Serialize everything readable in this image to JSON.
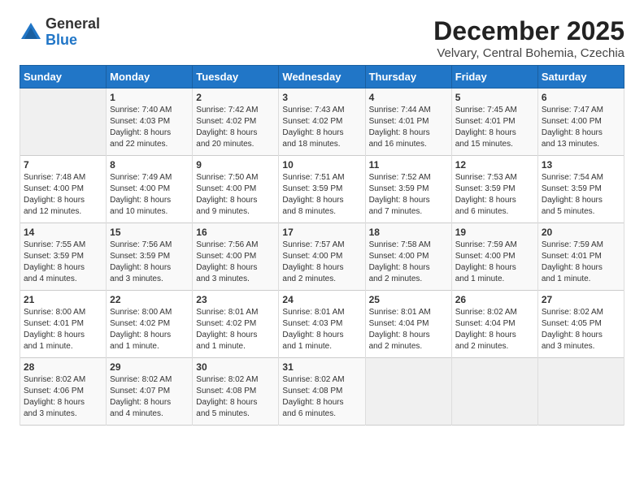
{
  "logo": {
    "general": "General",
    "blue": "Blue"
  },
  "header": {
    "month": "December 2025",
    "location": "Velvary, Central Bohemia, Czechia"
  },
  "days_of_week": [
    "Sunday",
    "Monday",
    "Tuesday",
    "Wednesday",
    "Thursday",
    "Friday",
    "Saturday"
  ],
  "weeks": [
    [
      {
        "day": "",
        "info": ""
      },
      {
        "day": "1",
        "info": "Sunrise: 7:40 AM\nSunset: 4:03 PM\nDaylight: 8 hours\nand 22 minutes."
      },
      {
        "day": "2",
        "info": "Sunrise: 7:42 AM\nSunset: 4:02 PM\nDaylight: 8 hours\nand 20 minutes."
      },
      {
        "day": "3",
        "info": "Sunrise: 7:43 AM\nSunset: 4:02 PM\nDaylight: 8 hours\nand 18 minutes."
      },
      {
        "day": "4",
        "info": "Sunrise: 7:44 AM\nSunset: 4:01 PM\nDaylight: 8 hours\nand 16 minutes."
      },
      {
        "day": "5",
        "info": "Sunrise: 7:45 AM\nSunset: 4:01 PM\nDaylight: 8 hours\nand 15 minutes."
      },
      {
        "day": "6",
        "info": "Sunrise: 7:47 AM\nSunset: 4:00 PM\nDaylight: 8 hours\nand 13 minutes."
      }
    ],
    [
      {
        "day": "7",
        "info": "Sunrise: 7:48 AM\nSunset: 4:00 PM\nDaylight: 8 hours\nand 12 minutes."
      },
      {
        "day": "8",
        "info": "Sunrise: 7:49 AM\nSunset: 4:00 PM\nDaylight: 8 hours\nand 10 minutes."
      },
      {
        "day": "9",
        "info": "Sunrise: 7:50 AM\nSunset: 4:00 PM\nDaylight: 8 hours\nand 9 minutes."
      },
      {
        "day": "10",
        "info": "Sunrise: 7:51 AM\nSunset: 3:59 PM\nDaylight: 8 hours\nand 8 minutes."
      },
      {
        "day": "11",
        "info": "Sunrise: 7:52 AM\nSunset: 3:59 PM\nDaylight: 8 hours\nand 7 minutes."
      },
      {
        "day": "12",
        "info": "Sunrise: 7:53 AM\nSunset: 3:59 PM\nDaylight: 8 hours\nand 6 minutes."
      },
      {
        "day": "13",
        "info": "Sunrise: 7:54 AM\nSunset: 3:59 PM\nDaylight: 8 hours\nand 5 minutes."
      }
    ],
    [
      {
        "day": "14",
        "info": "Sunrise: 7:55 AM\nSunset: 3:59 PM\nDaylight: 8 hours\nand 4 minutes."
      },
      {
        "day": "15",
        "info": "Sunrise: 7:56 AM\nSunset: 3:59 PM\nDaylight: 8 hours\nand 3 minutes."
      },
      {
        "day": "16",
        "info": "Sunrise: 7:56 AM\nSunset: 4:00 PM\nDaylight: 8 hours\nand 3 minutes."
      },
      {
        "day": "17",
        "info": "Sunrise: 7:57 AM\nSunset: 4:00 PM\nDaylight: 8 hours\nand 2 minutes."
      },
      {
        "day": "18",
        "info": "Sunrise: 7:58 AM\nSunset: 4:00 PM\nDaylight: 8 hours\nand 2 minutes."
      },
      {
        "day": "19",
        "info": "Sunrise: 7:59 AM\nSunset: 4:00 PM\nDaylight: 8 hours\nand 1 minute."
      },
      {
        "day": "20",
        "info": "Sunrise: 7:59 AM\nSunset: 4:01 PM\nDaylight: 8 hours\nand 1 minute."
      }
    ],
    [
      {
        "day": "21",
        "info": "Sunrise: 8:00 AM\nSunset: 4:01 PM\nDaylight: 8 hours\nand 1 minute."
      },
      {
        "day": "22",
        "info": "Sunrise: 8:00 AM\nSunset: 4:02 PM\nDaylight: 8 hours\nand 1 minute."
      },
      {
        "day": "23",
        "info": "Sunrise: 8:01 AM\nSunset: 4:02 PM\nDaylight: 8 hours\nand 1 minute."
      },
      {
        "day": "24",
        "info": "Sunrise: 8:01 AM\nSunset: 4:03 PM\nDaylight: 8 hours\nand 1 minute."
      },
      {
        "day": "25",
        "info": "Sunrise: 8:01 AM\nSunset: 4:04 PM\nDaylight: 8 hours\nand 2 minutes."
      },
      {
        "day": "26",
        "info": "Sunrise: 8:02 AM\nSunset: 4:04 PM\nDaylight: 8 hours\nand 2 minutes."
      },
      {
        "day": "27",
        "info": "Sunrise: 8:02 AM\nSunset: 4:05 PM\nDaylight: 8 hours\nand 3 minutes."
      }
    ],
    [
      {
        "day": "28",
        "info": "Sunrise: 8:02 AM\nSunset: 4:06 PM\nDaylight: 8 hours\nand 3 minutes."
      },
      {
        "day": "29",
        "info": "Sunrise: 8:02 AM\nSunset: 4:07 PM\nDaylight: 8 hours\nand 4 minutes."
      },
      {
        "day": "30",
        "info": "Sunrise: 8:02 AM\nSunset: 4:08 PM\nDaylight: 8 hours\nand 5 minutes."
      },
      {
        "day": "31",
        "info": "Sunrise: 8:02 AM\nSunset: 4:08 PM\nDaylight: 8 hours\nand 6 minutes."
      },
      {
        "day": "",
        "info": ""
      },
      {
        "day": "",
        "info": ""
      },
      {
        "day": "",
        "info": ""
      }
    ]
  ]
}
